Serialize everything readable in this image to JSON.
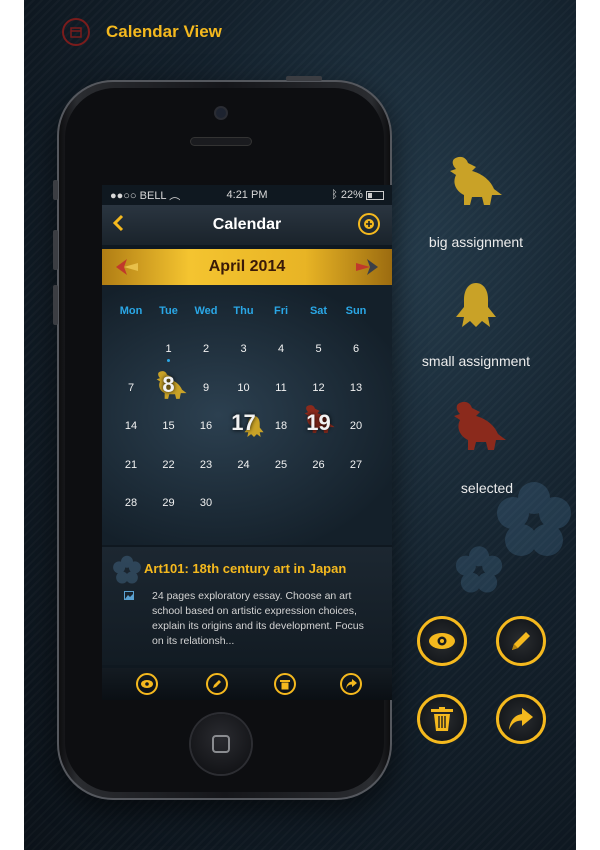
{
  "header": {
    "title": "Calendar View"
  },
  "status": {
    "carrier": "BELL",
    "time": "4:21 PM",
    "battery": "22%"
  },
  "nav": {
    "back": "‹",
    "title": "Calendar"
  },
  "month": {
    "label": "April 2014"
  },
  "weekdays": [
    "Mon",
    "Tue",
    "Wed",
    "Thu",
    "Fri",
    "Sat",
    "Sun"
  ],
  "weeks": [
    [
      "",
      "1",
      "2",
      "3",
      "4",
      "5",
      "6"
    ],
    [
      "7",
      "8",
      "9",
      "10",
      "11",
      "12",
      "13"
    ],
    [
      "14",
      "15",
      "16",
      "17",
      "18",
      "19",
      "20"
    ],
    [
      "21",
      "22",
      "23",
      "24",
      "25",
      "26",
      "27"
    ],
    [
      "28",
      "29",
      "30",
      "",
      "",
      "",
      ""
    ]
  ],
  "markers": {
    "big": "8",
    "small": "17",
    "selected": "19",
    "dot": "1"
  },
  "assignment": {
    "title": "Art101: 18th century art in Japan",
    "description": "24 pages exploratory essay. Choose an art school based on artistic expression choices, explain its origins and its development. Focus on its relationsh..."
  },
  "toolbar": [
    "eye-icon",
    "pencil-icon",
    "trash-icon",
    "share-icon"
  ],
  "legend": [
    {
      "label": "big assignment",
      "color": "#c9a227"
    },
    {
      "label": "small assignment",
      "color": "#c9a227"
    },
    {
      "label": "selected",
      "color": "#8b2a1c"
    }
  ],
  "colors": {
    "accent": "#f5b91e",
    "weekday": "#2aa7e6",
    "selected": "#8b2a1c"
  }
}
